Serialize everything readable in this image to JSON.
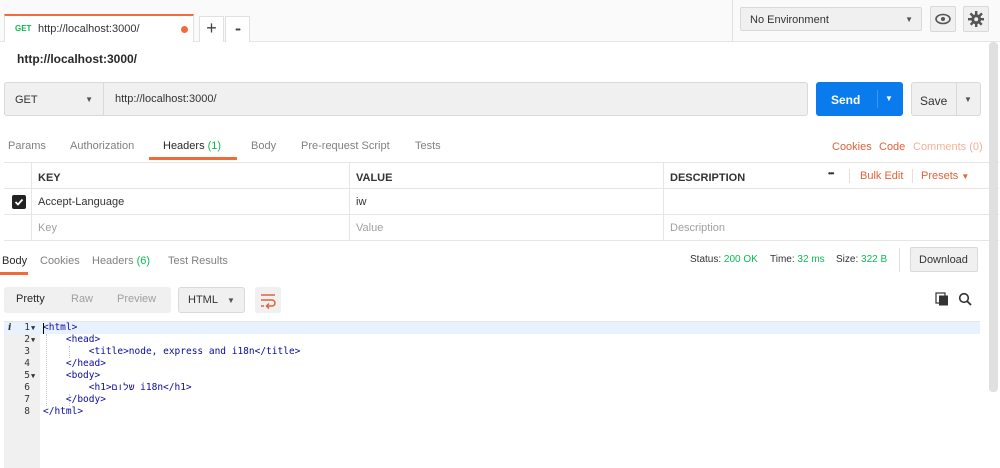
{
  "tab": {
    "method": "GET",
    "title": "http://localhost:3000/"
  },
  "tabbar": {
    "plus": "+",
    "more": "•••"
  },
  "environment": {
    "selected": "No Environment"
  },
  "request": {
    "name": "http://localhost:3000/",
    "method": "GET",
    "url": "http://localhost:3000/",
    "send_label": "Send",
    "save_label": "Save"
  },
  "request_tabs": {
    "params": "Params",
    "authorization": "Authorization",
    "headers": "Headers",
    "headers_count": "(1)",
    "body": "Body",
    "prerequest": "Pre-request Script",
    "tests": "Tests",
    "cookies": "Cookies",
    "code": "Code",
    "comments": "Comments (0)"
  },
  "headers_table": {
    "col_key": "KEY",
    "col_value": "VALUE",
    "col_description": "DESCRIPTION",
    "more": "•••",
    "bulk_edit": "Bulk Edit",
    "presets": "Presets",
    "rows": [
      {
        "key": "Accept-Language",
        "value": "iw",
        "description": "",
        "checked": true
      }
    ],
    "placeholder": {
      "key": "Key",
      "value": "Value",
      "description": "Description"
    }
  },
  "response": {
    "tabs": {
      "body": "Body",
      "cookies": "Cookies",
      "headers": "Headers",
      "headers_count": "(6)",
      "tests": "Test Results"
    },
    "status_label": "Status:",
    "status": "200 OK",
    "time_label": "Time:",
    "time": "32 ms",
    "size_label": "Size:",
    "size": "322 B",
    "download_label": "Download"
  },
  "format": {
    "pretty": "Pretty",
    "raw": "Raw",
    "preview": "Preview",
    "language": "HTML"
  },
  "code_lines": [
    {
      "num": "1",
      "text": "<html>"
    },
    {
      "num": "2",
      "text": "    <head>"
    },
    {
      "num": "3",
      "text": "        <title>node, express and i18n</title>"
    },
    {
      "num": "4",
      "text": "    </head>"
    },
    {
      "num": "5",
      "text": "    <body>"
    },
    {
      "num": "6",
      "text": "        <h1>שלום i18n</h1>"
    },
    {
      "num": "7",
      "text": "    </body>"
    },
    {
      "num": "8",
      "text": "</html>"
    }
  ],
  "colors": {
    "accent": "#f26b3a",
    "send": "#097bed",
    "success": "#0cbb52"
  },
  "icons": [
    "plus-icon",
    "eye-icon",
    "gear-icon",
    "caret-down-icon",
    "check-icon",
    "wrap-icon",
    "copy-icon",
    "search-icon",
    "info-icon",
    "fold-arrow-icon"
  ]
}
